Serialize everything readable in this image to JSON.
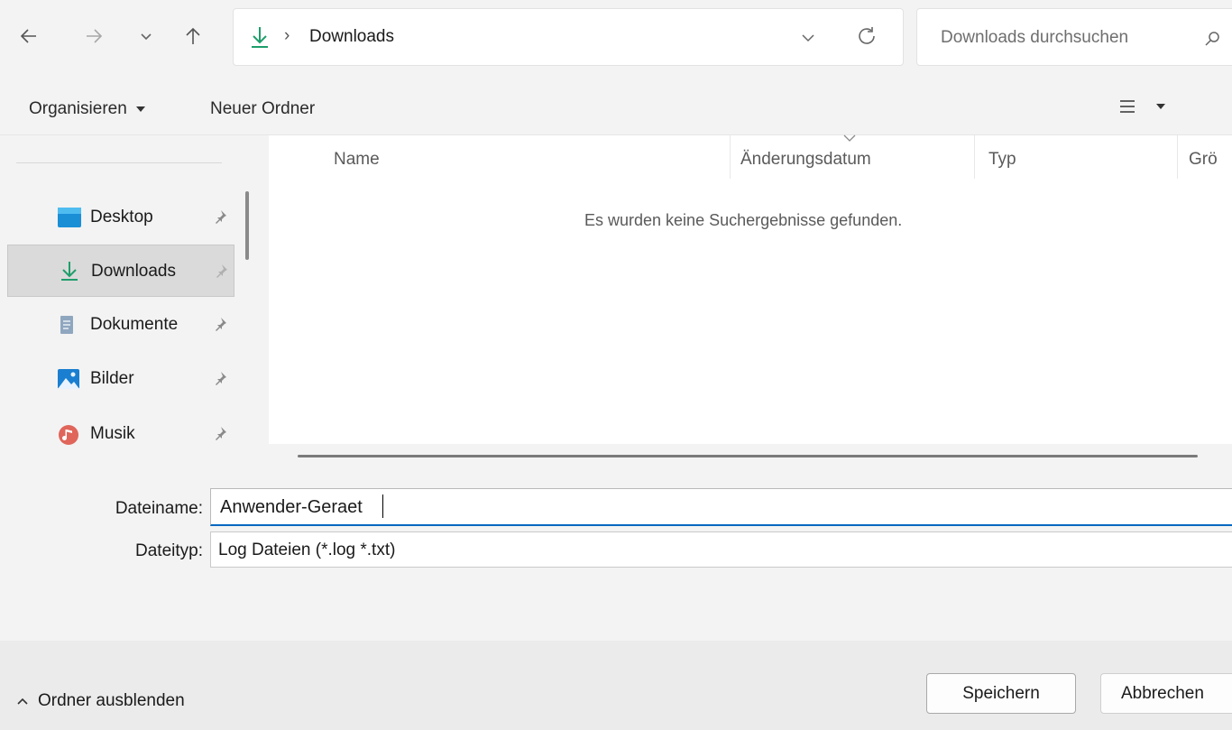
{
  "address": {
    "crumb_separator": "›",
    "current_folder": "Downloads"
  },
  "search": {
    "placeholder": "Downloads durchsuchen"
  },
  "toolbar": {
    "organize_label": "Organisieren",
    "new_folder_label": "Neuer Ordner"
  },
  "sidebar": {
    "items": [
      {
        "label": "Desktop",
        "icon": "desktop-icon",
        "selected": false
      },
      {
        "label": "Downloads",
        "icon": "download-icon",
        "selected": true
      },
      {
        "label": "Dokumente",
        "icon": "document-icon",
        "selected": false
      },
      {
        "label": "Bilder",
        "icon": "pictures-icon",
        "selected": false
      },
      {
        "label": "Musik",
        "icon": "music-icon",
        "selected": false
      }
    ]
  },
  "file_list": {
    "columns": [
      "Name",
      "Änderungsdatum",
      "Typ",
      "Grö"
    ],
    "sorted_column": "Änderungsdatum",
    "empty_message": "Es wurden keine Suchergebnisse gefunden."
  },
  "form": {
    "filename_label": "Dateiname:",
    "filename_value": "Anwender-Geraet",
    "filetype_label": "Dateityp:",
    "filetype_value": "Log Dateien (*.log *.txt)"
  },
  "footer": {
    "hide_folders_label": "Ordner ausblenden",
    "save_label": "Speichern",
    "cancel_label": "Abbrechen"
  },
  "colors": {
    "accent": "#0067c0",
    "download_green": "#1e9e6b"
  }
}
